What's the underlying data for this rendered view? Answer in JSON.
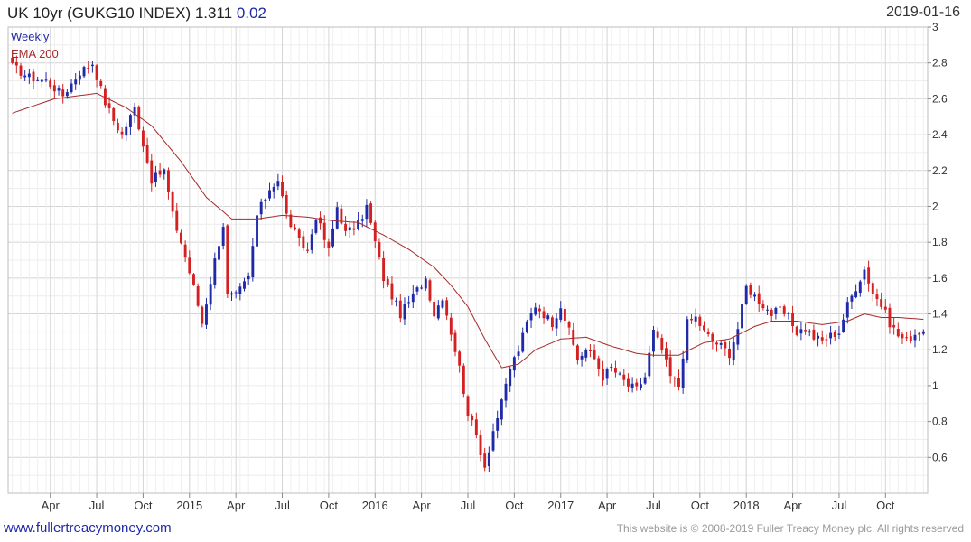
{
  "header": {
    "title_prefix": "UK 10yr (GUKG10 INDEX) 1.311",
    "change": "0.02",
    "date": "2019-01-16"
  },
  "footer": {
    "site": "www.fullertreacymoney.com",
    "copyright": "This website is © 2008-2019 Fuller Treacy Money plc. All rights reserved"
  },
  "colors": {
    "up": "#1f2aa8",
    "down": "#d42020",
    "ema": "#a52a2a",
    "grid": "#d9d9d9",
    "frame": "#bdbdbd"
  },
  "chart_data": {
    "type": "candlestick",
    "periodicity_label": "Weekly",
    "ema_label": "EMA 200",
    "ylim": [
      0.4,
      3.0
    ],
    "yticks": [
      0.6,
      0.8,
      1,
      1.2,
      1.4,
      1.6,
      1.8,
      2,
      2.2,
      2.4,
      2.6,
      2.8,
      3
    ],
    "xlim": [
      -1,
      217
    ],
    "xticks": [
      {
        "label": "Apr",
        "x": 9
      },
      {
        "label": "Jul",
        "x": 20
      },
      {
        "label": "Oct",
        "x": 31
      },
      {
        "label": "2015",
        "x": 42
      },
      {
        "label": "Apr",
        "x": 53
      },
      {
        "label": "Jul",
        "x": 64
      },
      {
        "label": "Oct",
        "x": 75
      },
      {
        "label": "2016",
        "x": 86
      },
      {
        "label": "Apr",
        "x": 97
      },
      {
        "label": "Jul",
        "x": 108
      },
      {
        "label": "Oct",
        "x": 119
      },
      {
        "label": "2017",
        "x": 130
      },
      {
        "label": "Apr",
        "x": 141
      },
      {
        "label": "Jul",
        "x": 152
      },
      {
        "label": "Oct",
        "x": 163
      },
      {
        "label": "2018",
        "x": 174
      },
      {
        "label": "Apr",
        "x": 185
      },
      {
        "label": "Jul",
        "x": 196
      },
      {
        "label": "Oct",
        "x": 207
      }
    ],
    "close_anchors": [
      [
        0,
        2.78
      ],
      [
        4,
        2.72
      ],
      [
        8,
        2.7
      ],
      [
        12,
        2.62
      ],
      [
        16,
        2.75
      ],
      [
        19,
        2.8
      ],
      [
        22,
        2.58
      ],
      [
        24,
        2.48
      ],
      [
        26,
        2.4
      ],
      [
        29,
        2.55
      ],
      [
        31,
        2.35
      ],
      [
        33,
        2.15
      ],
      [
        36,
        2.2
      ],
      [
        38,
        1.95
      ],
      [
        40,
        1.8
      ],
      [
        43,
        1.55
      ],
      [
        45,
        1.35
      ],
      [
        48,
        1.7
      ],
      [
        50,
        1.9
      ],
      [
        51,
        1.5
      ],
      [
        53,
        1.5
      ],
      [
        56,
        1.6
      ],
      [
        58,
        1.95
      ],
      [
        61,
        2.1
      ],
      [
        63,
        2.15
      ],
      [
        65,
        1.95
      ],
      [
        68,
        1.8
      ],
      [
        70,
        1.75
      ],
      [
        72,
        1.95
      ],
      [
        75,
        1.75
      ],
      [
        77,
        2.0
      ],
      [
        79,
        1.85
      ],
      [
        82,
        1.9
      ],
      [
        84,
        2.0
      ],
      [
        86,
        1.8
      ],
      [
        88,
        1.6
      ],
      [
        90,
        1.5
      ],
      [
        92,
        1.4
      ],
      [
        95,
        1.5
      ],
      [
        98,
        1.6
      ],
      [
        100,
        1.4
      ],
      [
        102,
        1.5
      ],
      [
        104,
        1.3
      ],
      [
        106,
        1.1
      ],
      [
        108,
        0.85
      ],
      [
        110,
        0.72
      ],
      [
        112,
        0.55
      ],
      [
        114,
        0.75
      ],
      [
        116,
        0.9
      ],
      [
        118,
        1.1
      ],
      [
        120,
        1.2
      ],
      [
        122,
        1.35
      ],
      [
        124,
        1.45
      ],
      [
        126,
        1.4
      ],
      [
        128,
        1.35
      ],
      [
        130,
        1.45
      ],
      [
        132,
        1.3
      ],
      [
        134,
        1.15
      ],
      [
        136,
        1.2
      ],
      [
        138,
        1.15
      ],
      [
        140,
        1.05
      ],
      [
        142,
        1.1
      ],
      [
        144,
        1.05
      ],
      [
        146,
        1.0
      ],
      [
        148,
        0.98
      ],
      [
        150,
        1.05
      ],
      [
        152,
        1.3
      ],
      [
        154,
        1.2
      ],
      [
        156,
        1.05
      ],
      [
        158,
        1.0
      ],
      [
        160,
        1.35
      ],
      [
        162,
        1.38
      ],
      [
        164,
        1.3
      ],
      [
        166,
        1.25
      ],
      [
        168,
        1.22
      ],
      [
        170,
        1.18
      ],
      [
        172,
        1.32
      ],
      [
        174,
        1.55
      ],
      [
        176,
        1.5
      ],
      [
        178,
        1.45
      ],
      [
        180,
        1.4
      ],
      [
        182,
        1.42
      ],
      [
        184,
        1.38
      ],
      [
        186,
        1.3
      ],
      [
        188,
        1.32
      ],
      [
        190,
        1.27
      ],
      [
        192,
        1.25
      ],
      [
        194,
        1.28
      ],
      [
        196,
        1.3
      ],
      [
        198,
        1.45
      ],
      [
        200,
        1.55
      ],
      [
        202,
        1.65
      ],
      [
        204,
        1.52
      ],
      [
        206,
        1.45
      ],
      [
        208,
        1.35
      ],
      [
        210,
        1.28
      ],
      [
        212,
        1.25
      ],
      [
        214,
        1.29
      ],
      [
        216,
        1.311
      ]
    ],
    "ema_anchors": [
      [
        0,
        2.52
      ],
      [
        10,
        2.6
      ],
      [
        20,
        2.63
      ],
      [
        27,
        2.55
      ],
      [
        33,
        2.45
      ],
      [
        40,
        2.25
      ],
      [
        46,
        2.05
      ],
      [
        52,
        1.93
      ],
      [
        58,
        1.93
      ],
      [
        64,
        1.95
      ],
      [
        70,
        1.94
      ],
      [
        76,
        1.92
      ],
      [
        82,
        1.91
      ],
      [
        88,
        1.84
      ],
      [
        94,
        1.76
      ],
      [
        100,
        1.66
      ],
      [
        104,
        1.56
      ],
      [
        108,
        1.44
      ],
      [
        112,
        1.26
      ],
      [
        116,
        1.1
      ],
      [
        120,
        1.12
      ],
      [
        124,
        1.2
      ],
      [
        130,
        1.26
      ],
      [
        136,
        1.27
      ],
      [
        142,
        1.22
      ],
      [
        148,
        1.18
      ],
      [
        152,
        1.17
      ],
      [
        158,
        1.17
      ],
      [
        164,
        1.24
      ],
      [
        170,
        1.26
      ],
      [
        176,
        1.33
      ],
      [
        180,
        1.36
      ],
      [
        186,
        1.36
      ],
      [
        192,
        1.34
      ],
      [
        198,
        1.36
      ],
      [
        202,
        1.4
      ],
      [
        206,
        1.38
      ],
      [
        210,
        1.38
      ],
      [
        216,
        1.37
      ]
    ]
  }
}
